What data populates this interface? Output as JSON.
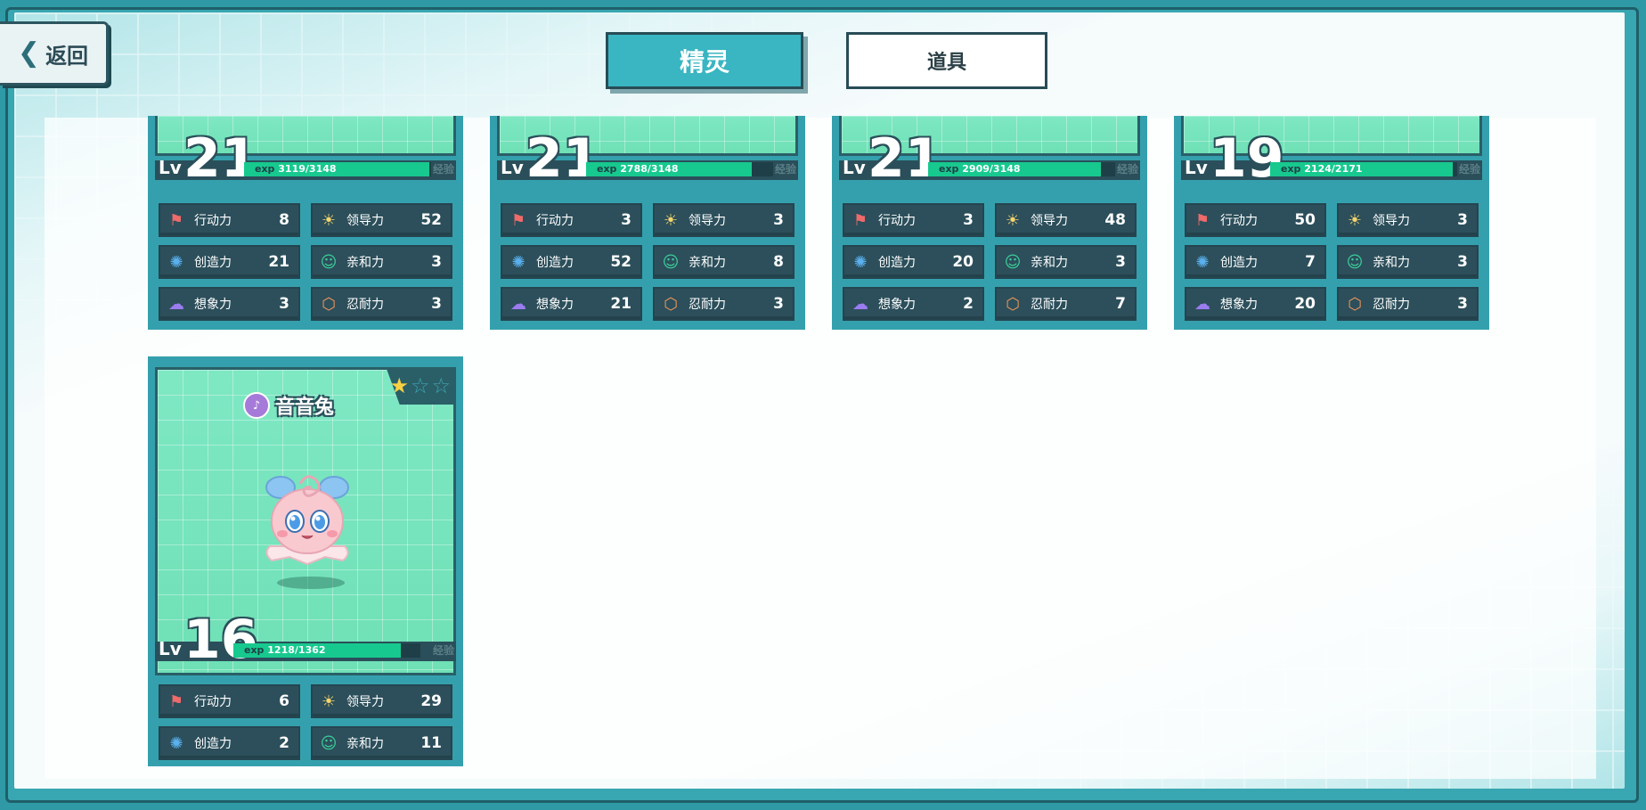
{
  "header": {
    "back_label": "返回",
    "tabs": [
      {
        "label": "精灵",
        "active": true
      },
      {
        "label": "道具",
        "active": false
      }
    ]
  },
  "stat_labels": {
    "action": "行动力",
    "lead": "领导力",
    "create": "创造力",
    "affinity": "亲和力",
    "imagine": "想象力",
    "endure": "忍耐力"
  },
  "level_prefix": "Lv",
  "exp_prefix": "exp",
  "exp_tag": "经验",
  "cards": [
    {
      "level": "21",
      "exp_cur": "3119",
      "exp_max": "/3148",
      "exp_fraction": 0.99,
      "stats": {
        "action": "8",
        "lead": "52",
        "create": "21",
        "affinity": "3",
        "imagine": "3",
        "endure": "3"
      }
    },
    {
      "level": "21",
      "exp_cur": "2788",
      "exp_max": "/3148",
      "exp_fraction": 0.886,
      "stats": {
        "action": "3",
        "lead": "3",
        "create": "52",
        "affinity": "8",
        "imagine": "21",
        "endure": "3"
      }
    },
    {
      "level": "21",
      "exp_cur": "2909",
      "exp_max": "/3148",
      "exp_fraction": 0.924,
      "stats": {
        "action": "3",
        "lead": "48",
        "create": "20",
        "affinity": "3",
        "imagine": "2",
        "endure": "7"
      }
    },
    {
      "level": "19",
      "exp_cur": "2124",
      "exp_max": "/2171",
      "exp_fraction": 0.978,
      "stats": {
        "action": "50",
        "lead": "3",
        "create": "7",
        "affinity": "3",
        "imagine": "20",
        "endure": "3"
      }
    },
    {
      "name": "音音兔",
      "stars": 1,
      "stars_max": 3,
      "level": "16",
      "exp_cur": "1218",
      "exp_max": "/1362",
      "exp_fraction": 0.894,
      "stats": {
        "action": "6",
        "lead": "29",
        "create": "2",
        "affinity": "11"
      }
    }
  ],
  "colors": {
    "accent": "#3ab5c2",
    "card": "#35a0ad",
    "exp_fill": "#17c98e",
    "stat_bg": "#2c4f5b"
  },
  "icons": {
    "back": "chevron-left-icon",
    "action": "running-icon",
    "lead": "sunrise-icon",
    "create": "lightbulb-icon",
    "affinity": "smile-icon",
    "imagine": "cloud-icon",
    "endure": "shield-icon",
    "type": "music-note-icon",
    "star": "star-icon"
  }
}
